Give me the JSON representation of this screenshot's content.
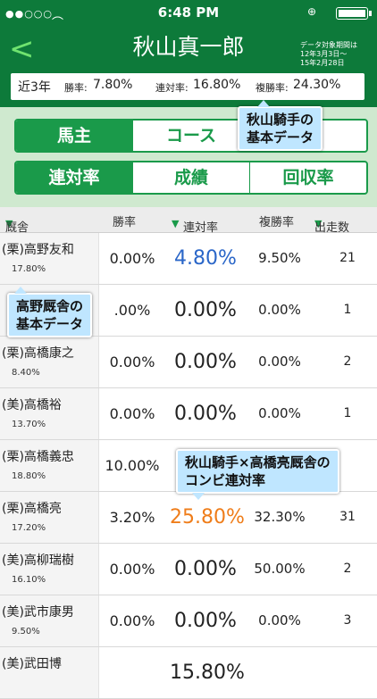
{
  "status_bar": {
    "signal": "●●○○○",
    "time": "6:48 PM",
    "lock": "⊕"
  },
  "header": {
    "back": "<",
    "title": "秋山真一郎",
    "period": [
      "データ対象期間は",
      "12年3月3日〜",
      "15年2月28日"
    ]
  },
  "summary": {
    "period": "近3年",
    "win_label": "勝率:",
    "win": "7.80%",
    "rentai_label": "連対率:",
    "rentai": "16.80%",
    "fukusho_label": "複勝率:",
    "fukusho": "24.30%"
  },
  "segment_top": [
    "馬主",
    "コース",
    ""
  ],
  "segment_bottom": [
    "連対率",
    "成績",
    "回収率"
  ],
  "columns": {
    "stable": "厩舎",
    "win": "勝率",
    "rentai": "連対率",
    "fukusho": "複勝率",
    "starts": "出走数"
  },
  "rows": [
    {
      "stable": "(栗)高野友和",
      "pct": "17.80%",
      "win": "0.00%",
      "rentai": "4.80%",
      "fukusho": "9.50%",
      "starts": "21"
    },
    {
      "stable": "",
      "pct": "",
      "win": ".00%",
      "rentai": "0.00%",
      "fukusho": "0.00%",
      "starts": "1"
    },
    {
      "stable": "(栗)高橋康之",
      "pct": "8.40%",
      "win": "0.00%",
      "rentai": "0.00%",
      "fukusho": "0.00%",
      "starts": "2"
    },
    {
      "stable": "(美)高橋裕",
      "pct": "13.70%",
      "win": "0.00%",
      "rentai": "0.00%",
      "fukusho": "0.00%",
      "starts": "1"
    },
    {
      "stable": "(栗)高橋義忠",
      "pct": "18.80%",
      "win": "10.00%",
      "rentai": "",
      "fukusho": "",
      "starts": ""
    },
    {
      "stable": "(栗)高橋亮",
      "pct": "17.20%",
      "win": "3.20%",
      "rentai": "25.80%",
      "fukusho": "32.30%",
      "starts": "31"
    },
    {
      "stable": "(美)高柳瑞樹",
      "pct": "16.10%",
      "win": "0.00%",
      "rentai": "0.00%",
      "fukusho": "50.00%",
      "starts": "2"
    },
    {
      "stable": "(美)武市康男",
      "pct": "9.50%",
      "win": "0.00%",
      "rentai": "0.00%",
      "fukusho": "0.00%",
      "starts": "3"
    },
    {
      "stable": "(美)武田博",
      "pct": "",
      "win": "",
      "rentai": "15.80%",
      "fukusho": "",
      "starts": ""
    }
  ],
  "callouts": {
    "jockey": [
      "秋山騎手の",
      "基本データ"
    ],
    "stable": [
      "高野厩舎の",
      "基本データ"
    ],
    "combo": [
      "秋山騎手×高橋亮厩舎の",
      "コンビ連対率"
    ]
  },
  "colors": {
    "header": "#0d7a3a",
    "accent": "#1a9a4a",
    "segment_bg": "#cfe9cf",
    "blue": "#2a66c8",
    "orange": "#ef7d1a",
    "callout": "#bfe6ff"
  }
}
